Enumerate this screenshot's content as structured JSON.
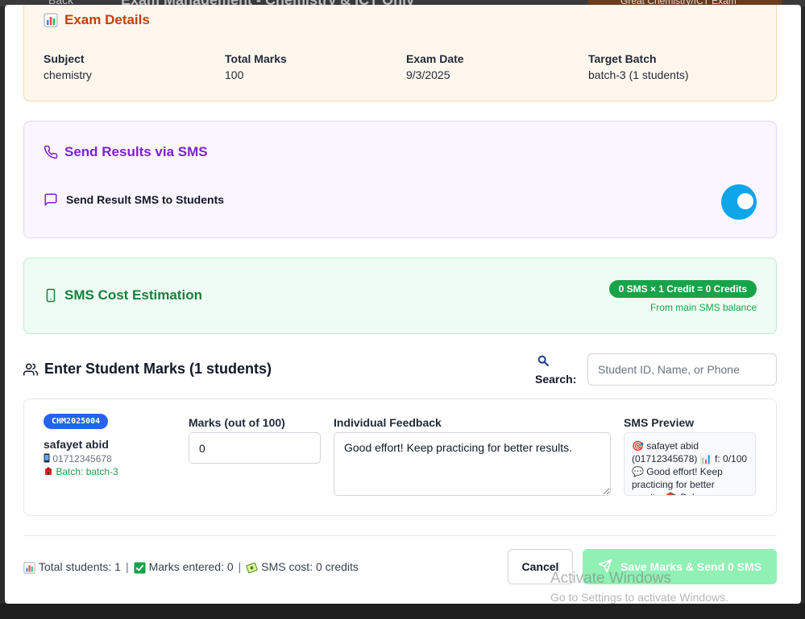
{
  "backdrop": {
    "back_label": "Back",
    "page_title": "Exam Management - Chemistry & ICT Only",
    "corner_label": "Great Chemistry/ICT Exam"
  },
  "exam_details": {
    "title": "Exam Details",
    "fields": [
      {
        "label": "Subject",
        "value": "chemistry"
      },
      {
        "label": "Total Marks",
        "value": "100"
      },
      {
        "label": "Exam Date",
        "value": "9/3/2025"
      },
      {
        "label": "Target Batch",
        "value": "batch-3 (1 students)"
      }
    ]
  },
  "sms_section": {
    "title": "Send Results via SMS",
    "toggle_label": "Send Result SMS to Students",
    "toggle_on": true
  },
  "cost": {
    "title": "SMS Cost Estimation",
    "badge": "0 SMS × 1 Credit = 0 Credits",
    "subtext": "From main SMS balance"
  },
  "marks": {
    "title": "Enter Student Marks (1 students)",
    "search_label": "Search:",
    "search_placeholder": "Student ID, Name, or Phone"
  },
  "student": {
    "id": "CHM2025004",
    "name": "safayet abid",
    "phone": "01712345678",
    "batch": "Batch: batch-3",
    "marks_label": "Marks (out of 100)",
    "marks_value": "0",
    "feedback_label": "Individual Feedback",
    "feedback_value": "Good effort! Keep practicing for better results.",
    "preview_label": "SMS Preview",
    "preview_text": "🎯 safayet abid (01712345678) 📊 f: 0/100 💬 Good effort! Keep practicing for better results. 📚 Bal"
  },
  "footer": {
    "total_students": "Total students: 1",
    "marks_entered": "Marks entered: 0",
    "sms_cost": "SMS cost: 0 credits",
    "cancel_label": "Cancel",
    "save_label": "Save Marks & Send 0 SMS"
  },
  "watermark": {
    "line1": "Activate Windows",
    "line2": "Go to Settings to activate Windows."
  },
  "colors": {
    "exam_accent": "#c2410c",
    "sms_accent": "#7e22ce",
    "cost_accent": "#15803d",
    "toggle": "#0ea5e9",
    "id_badge": "#2563eb",
    "save_button": "#86efac"
  }
}
